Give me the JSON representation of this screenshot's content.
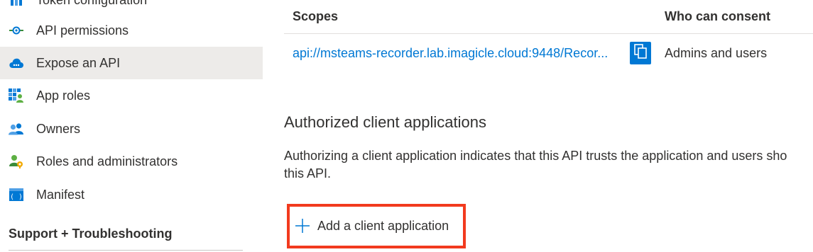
{
  "sidebar": {
    "items": [
      {
        "label": "Token configuration",
        "icon": "token-configuration-icon"
      },
      {
        "label": "API permissions",
        "icon": "api-permissions-icon"
      },
      {
        "label": "Expose an API",
        "icon": "cloud-icon",
        "selected": true
      },
      {
        "label": "App roles",
        "icon": "app-roles-icon"
      },
      {
        "label": "Owners",
        "icon": "owners-icon"
      },
      {
        "label": "Roles and administrators",
        "icon": "roles-administrators-icon"
      },
      {
        "label": "Manifest",
        "icon": "manifest-icon"
      }
    ],
    "section_header": "Support + Troubleshooting"
  },
  "scopes_table": {
    "columns": [
      "Scopes",
      "Who can consent"
    ],
    "rows": [
      {
        "scope": "api://msteams-recorder.lab.imagicle.cloud:9448/Recor...",
        "who_can_consent": "Admins and users"
      }
    ]
  },
  "authorized_clients": {
    "title": "Authorized client applications",
    "description_line1": "Authorizing a client application indicates that this API trusts the application and users sho",
    "description_line2": "this API.",
    "add_label": "Add a client application"
  },
  "colors": {
    "accent": "#0078d4",
    "selected_bg": "#edebe9",
    "highlight_box": "#f23a1e"
  }
}
